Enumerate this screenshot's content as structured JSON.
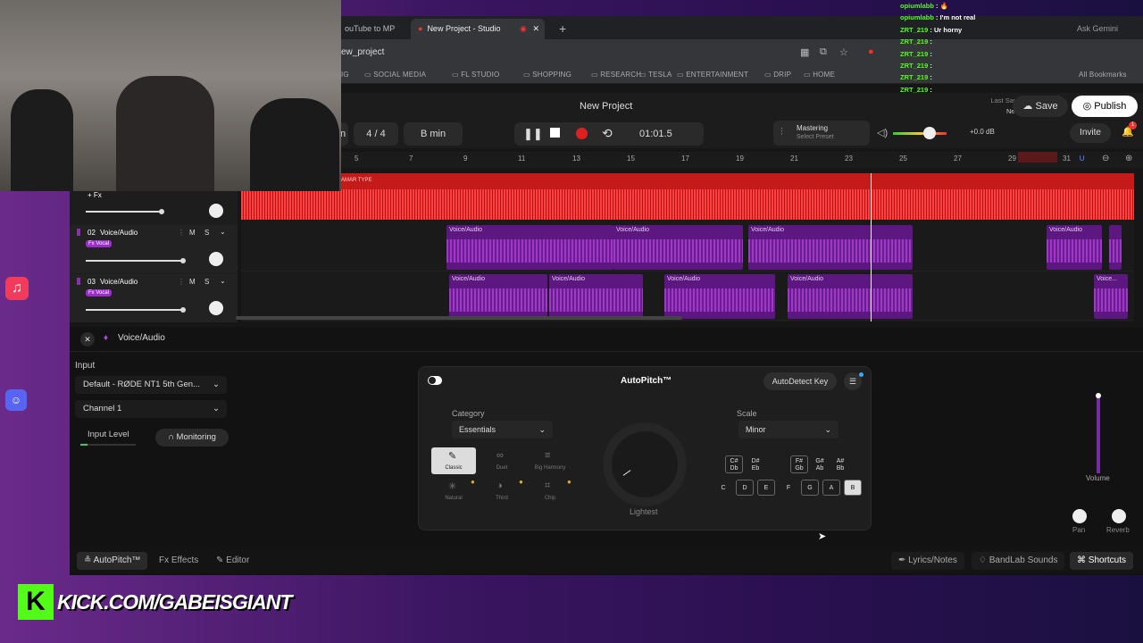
{
  "browser": {
    "tabs": [
      {
        "label": "ouTube to MP"
      },
      {
        "label": "New Project - Studio"
      }
    ],
    "new_tab": "+",
    "url": "ew_project",
    "gemini": "Ask Gemini",
    "bookmarks": [
      "IG",
      "SOCIAL MEDIA",
      "FL STUDIO",
      "SHOPPING",
      "RESEARCH",
      "TESLA",
      "ENTERTAINMENT",
      "DRIP",
      "HOME"
    ],
    "all_bookmarks": "All Bookmarks"
  },
  "studio": {
    "project_title": "New Project",
    "time_signature": "4 / 4",
    "key": "B min",
    "time": "01:01.5",
    "mastering": "Mastering",
    "mastering_sub": "Select Preset",
    "volume_db": "+0.0 dB",
    "last_saved_label": "Last Saved",
    "last_saved_value": "Never",
    "save": "Save",
    "publish": "Publish",
    "invite": "Invite",
    "notification_count": "1"
  },
  "ruler": [
    "5",
    "7",
    "9",
    "11",
    "13",
    "15",
    "17",
    "19",
    "21",
    "23",
    "25",
    "27",
    "29",
    "31"
  ],
  "tracks": [
    {
      "fx": "+ Fx",
      "number": "",
      "name": "",
      "tag": "",
      "beat_label": "AMAR TYPE"
    },
    {
      "number": "02",
      "name": "Voice/Audio",
      "tag": "Fx Vocal",
      "m": "M",
      "s": "S"
    },
    {
      "number": "03",
      "name": "Voice/Audio",
      "tag": "Fx Vocal",
      "m": "M",
      "s": "S"
    }
  ],
  "clips": {
    "lane2": [
      "Voice/Audio",
      "Voice/Audio",
      "Voice/Audio",
      "Voice/Audio"
    ],
    "lane3": [
      "Voice/Audio",
      "Voice/Audio",
      "Voice/Audio",
      "Voice/Audio",
      "Voice..."
    ]
  },
  "panel": {
    "track_name": "Voice/Audio",
    "input_label": "Input",
    "input_device": "Default - RØDE NT1 5th Gen...",
    "channel": "Channel 1",
    "input_level": "Input Level",
    "monitoring": "Monitoring"
  },
  "autopitch": {
    "title": "AutoPitch™",
    "autodetect": "AutoDetect Key",
    "category_label": "Category",
    "category_value": "Essentials",
    "modes": [
      "Classic",
      "Duet",
      "Big Harmony",
      "Natural",
      "Third",
      "Chip"
    ],
    "knob_label": "Lightest",
    "scale_label": "Scale",
    "scale_value": "Minor",
    "sharp_keys": [
      [
        "C#",
        "Db"
      ],
      [
        "D#",
        "Eb"
      ],
      [
        "F#",
        "Gb"
      ],
      [
        "G#",
        "Ab"
      ],
      [
        "A#",
        "Bb"
      ]
    ],
    "natural_keys": [
      "C",
      "D",
      "E",
      "F",
      "G",
      "A",
      "B"
    ]
  },
  "right_panel": {
    "volume": "Volume",
    "pan": "Pan",
    "reverb": "Reverb"
  },
  "bottom_bar": {
    "autopitch": "AutoPitch™",
    "effects": "Effects",
    "editor": "Editor",
    "lyrics": "Lyrics/Notes",
    "sounds": "BandLab Sounds",
    "shortcuts": "Shortcuts"
  },
  "chat": [
    {
      "user": "opiumlabb",
      "msg": ": 🔥"
    },
    {
      "user": "opiumlabb",
      "msg": ": I'm not real"
    },
    {
      "user": "ZRT_219",
      "msg": ": Ur horny"
    },
    {
      "user": "ZRT_219",
      "msg": ":"
    },
    {
      "user": "ZRT_219",
      "msg": ":"
    },
    {
      "user": "ZRT_219",
      "msg": ":"
    },
    {
      "user": "ZRT_219",
      "msg": ":"
    },
    {
      "user": "ZRT_219",
      "msg": ":"
    }
  ],
  "overlay": {
    "kick_logo": "K",
    "kick_url": "KICK.COM/GABEISGIANT"
  },
  "colors": {
    "accent_red": "#e02020",
    "clip_purple": "#5d1780",
    "kick_green": "#53fc18"
  }
}
